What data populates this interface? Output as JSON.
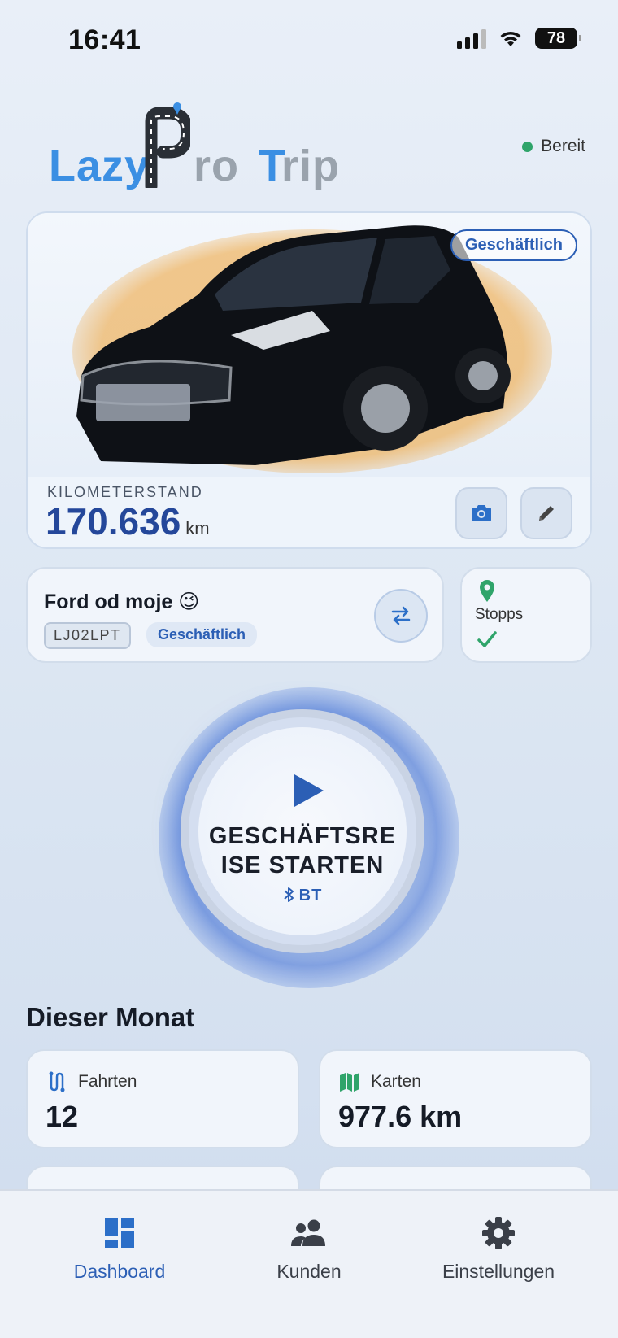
{
  "status_bar": {
    "time": "16:41",
    "battery": "78"
  },
  "header": {
    "logo": {
      "part1": "Lazy",
      "part2": "ro",
      "part3": "T",
      "part4": "rip"
    },
    "status_label": "Bereit",
    "status_color": "#2fa46a"
  },
  "vehicle_card": {
    "badge": "Geschäftlich",
    "odometer_label": "KILOMETERSTAND",
    "odometer_value": "170.636",
    "odometer_unit": "km",
    "camera_button": "camera-icon",
    "edit_button": "pencil-icon"
  },
  "trip": {
    "name": "Ford od  moje 😉",
    "plate": "LJ02LPT",
    "tag": "Geschäftlich",
    "swap_icon": "swap-arrows-icon"
  },
  "stops": {
    "label": "Stopps",
    "icon": "map-pin-icon",
    "status_icon": "check-icon"
  },
  "start_button": {
    "line1": "GESCHÄFTSRE",
    "line2": "ISE STARTEN",
    "bt_label": "BT",
    "accent": "#2c5fb5"
  },
  "this_month": {
    "title": "Dieser Monat",
    "stats": [
      {
        "label": "Fahrten",
        "value": "12",
        "icon": "route-icon"
      },
      {
        "label": "Karten",
        "value": "977.6 km",
        "icon": "map-icon"
      }
    ]
  },
  "bottom_nav": {
    "items": [
      {
        "label": "Dashboard",
        "icon": "dashboard-icon",
        "active": true
      },
      {
        "label": "Kunden",
        "icon": "users-icon",
        "active": false
      },
      {
        "label": "Einstellungen",
        "icon": "gear-icon",
        "active": false
      }
    ]
  }
}
